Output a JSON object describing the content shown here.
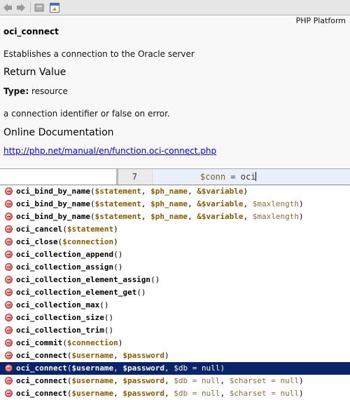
{
  "doc": {
    "toolbar": {
      "back_icon": "back-arrow-icon",
      "forward_icon": "forward-arrow-icon",
      "external_icon": "open-external-icon",
      "source_icon": "goto-source-icon"
    },
    "platform": "PHP Platform",
    "function_name": "oci_connect",
    "description": "Establishes a connection to the Oracle server",
    "return_heading": "Return Value",
    "type_label": "Type:",
    "type_value": "resource",
    "return_description": "a connection identifier or false on error.",
    "online_heading": "Online Documentation",
    "link": "http://php.net/manual/en/function.oci-connect.php"
  },
  "editor": {
    "line_number": "7",
    "code_var": "$conn",
    "code_rest": " = oci"
  },
  "completion": {
    "selected_index": 14,
    "colors": {
      "selected_bg": "#0a246a",
      "required_param": "#8a5a00",
      "optional_param": "#8a6d3b"
    },
    "items": [
      {
        "name": "oci_bind_by_name",
        "params": [
          {
            "text": "$statement",
            "kind": "req"
          },
          {
            "text": "$ph_name",
            "kind": "req"
          },
          {
            "text": "&$variable",
            "kind": "req"
          }
        ]
      },
      {
        "name": "oci_bind_by_name",
        "params": [
          {
            "text": "$statement",
            "kind": "req"
          },
          {
            "text": "$ph_name",
            "kind": "req"
          },
          {
            "text": "&$variable",
            "kind": "req"
          },
          {
            "text": "$maxlength",
            "kind": "opt"
          }
        ]
      },
      {
        "name": "oci_bind_by_name",
        "params": [
          {
            "text": "$statement",
            "kind": "req"
          },
          {
            "text": "$ph_name",
            "kind": "req"
          },
          {
            "text": "&$variable",
            "kind": "req"
          },
          {
            "text": "$maxlength",
            "kind": "opt"
          }
        ]
      },
      {
        "name": "oci_cancel",
        "params": [
          {
            "text": "$statement",
            "kind": "req"
          }
        ]
      },
      {
        "name": "oci_close",
        "params": [
          {
            "text": "$connection",
            "kind": "req"
          }
        ]
      },
      {
        "name": "oci_collection_append",
        "params": []
      },
      {
        "name": "oci_collection_assign",
        "params": []
      },
      {
        "name": "oci_collection_element_assign",
        "params": []
      },
      {
        "name": "oci_collection_element_get",
        "params": []
      },
      {
        "name": "oci_collection_max",
        "params": []
      },
      {
        "name": "oci_collection_size",
        "params": []
      },
      {
        "name": "oci_collection_trim",
        "params": []
      },
      {
        "name": "oci_commit",
        "params": [
          {
            "text": "$connection",
            "kind": "req"
          }
        ]
      },
      {
        "name": "oci_connect",
        "params": [
          {
            "text": "$username",
            "kind": "req"
          },
          {
            "text": "$password",
            "kind": "req"
          }
        ]
      },
      {
        "name": "oci_connect",
        "params": [
          {
            "text": "$username",
            "kind": "req"
          },
          {
            "text": "$password",
            "kind": "req"
          },
          {
            "text": "$db = null",
            "kind": "opt"
          }
        ]
      },
      {
        "name": "oci_connect",
        "params": [
          {
            "text": "$username",
            "kind": "req"
          },
          {
            "text": "$password",
            "kind": "req"
          },
          {
            "text": "$db = null",
            "kind": "opt"
          },
          {
            "text": "$charset = null",
            "kind": "opt"
          }
        ]
      },
      {
        "name": "oci_connect",
        "params": [
          {
            "text": "$username",
            "kind": "req"
          },
          {
            "text": "$password",
            "kind": "req"
          },
          {
            "text": "$db = null",
            "kind": "opt"
          },
          {
            "text": "$charset = null",
            "kind": "opt"
          }
        ]
      }
    ]
  }
}
